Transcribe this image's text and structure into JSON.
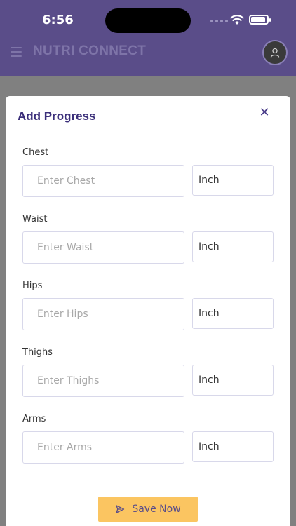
{
  "status_bar": {
    "time": "6:56"
  },
  "header": {
    "title": "NUTRI CONNECT"
  },
  "modal": {
    "title": "Add Progress",
    "close_symbol": "✕",
    "fields": [
      {
        "label": "Chest",
        "placeholder": "Enter Chest",
        "unit": "Inch"
      },
      {
        "label": "Waist",
        "placeholder": "Enter Waist",
        "unit": "Inch"
      },
      {
        "label": "Hips",
        "placeholder": "Enter Hips",
        "unit": "Inch"
      },
      {
        "label": "Thighs",
        "placeholder": "Enter Thighs",
        "unit": "Inch"
      },
      {
        "label": "Arms",
        "placeholder": "Enter Arms",
        "unit": "Inch"
      }
    ],
    "save_label": "Save Now"
  },
  "icons": {
    "menu": "menu-icon",
    "avatar": "user-icon",
    "close": "close-icon",
    "send": "send-icon",
    "wifi": "wifi-icon",
    "battery": "battery-icon"
  },
  "colors": {
    "header_bg": "#5a4d89",
    "title_purple": "#3b2f7a",
    "button_yellow": "#fbc561",
    "overlay": "#808080"
  }
}
